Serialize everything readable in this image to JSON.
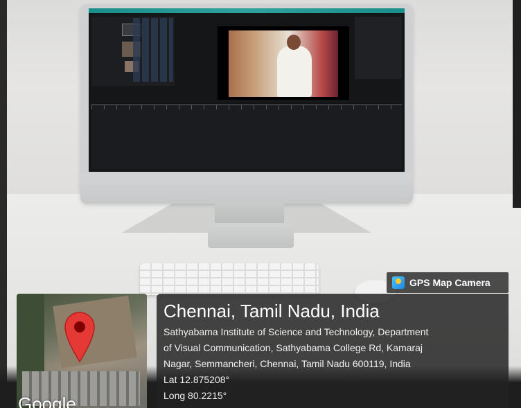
{
  "gps_badge": {
    "label": "GPS Map Camera",
    "icon": "gps-map-camera-icon"
  },
  "location": {
    "title": "Chennai, Tamil Nadu, India",
    "address_lines": [
      "Sathyabama Institute of Science and Technology, Department",
      "of Visual Communication, Sathyabama College Rd, Kamaraj",
      "Nagar, Semmancheri, Chennai, Tamil Nadu 600119, India"
    ],
    "lat": "Lat 12.875208°",
    "long": "Long 80.2215°"
  },
  "map": {
    "pin_icon": "map-pin-icon",
    "watermark": "Google",
    "pin_color": "#e53935"
  },
  "colors": {
    "overlay_bg": "#232323",
    "screen_menubar": "#1b8d8a"
  }
}
